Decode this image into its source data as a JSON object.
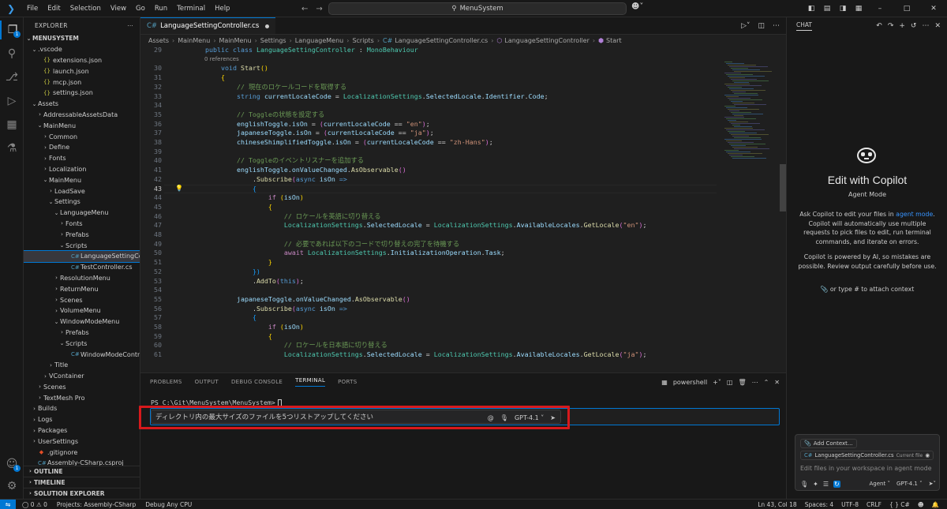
{
  "menubar": [
    "File",
    "Edit",
    "Selection",
    "View",
    "Go",
    "Run",
    "Terminal",
    "Help"
  ],
  "command_center": "MenuSystem",
  "explorer": {
    "title": "EXPLORER",
    "root": "MENUSYSTEM",
    "rows": [
      {
        "depth": 1,
        "type": "folder-open",
        "label": ".vscode"
      },
      {
        "depth": 2,
        "type": "json",
        "label": "extensions.json"
      },
      {
        "depth": 2,
        "type": "json",
        "label": "launch.json"
      },
      {
        "depth": 2,
        "type": "json",
        "label": "mcp.json"
      },
      {
        "depth": 2,
        "type": "json",
        "label": "settings.json"
      },
      {
        "depth": 1,
        "type": "folder-open",
        "label": "Assets"
      },
      {
        "depth": 2,
        "type": "folder",
        "label": "AddressableAssetsData"
      },
      {
        "depth": 2,
        "type": "folder-open",
        "label": "MainMenu"
      },
      {
        "depth": 3,
        "type": "folder",
        "label": "Common"
      },
      {
        "depth": 3,
        "type": "folder",
        "label": "Define"
      },
      {
        "depth": 3,
        "type": "folder",
        "label": "Fonts"
      },
      {
        "depth": 3,
        "type": "folder",
        "label": "Localization"
      },
      {
        "depth": 3,
        "type": "folder-open",
        "label": "MainMenu"
      },
      {
        "depth": 4,
        "type": "folder",
        "label": "LoadSave"
      },
      {
        "depth": 4,
        "type": "folder-open",
        "label": "Settings"
      },
      {
        "depth": 5,
        "type": "folder-open",
        "label": "LanguageMenu"
      },
      {
        "depth": 6,
        "type": "folder",
        "label": "Fonts"
      },
      {
        "depth": 6,
        "type": "folder",
        "label": "Prefabs"
      },
      {
        "depth": 6,
        "type": "folder-open",
        "label": "Scripts"
      },
      {
        "depth": 7,
        "type": "cs",
        "label": "LanguageSettingControll...",
        "selected": true
      },
      {
        "depth": 7,
        "type": "cs",
        "label": "TestController.cs"
      },
      {
        "depth": 5,
        "type": "folder",
        "label": "ResolutionMenu"
      },
      {
        "depth": 5,
        "type": "folder",
        "label": "ReturnMenu"
      },
      {
        "depth": 5,
        "type": "folder",
        "label": "Scenes"
      },
      {
        "depth": 5,
        "type": "folder",
        "label": "VolumeMenu"
      },
      {
        "depth": 5,
        "type": "folder-open",
        "label": "WindowModeMenu"
      },
      {
        "depth": 6,
        "type": "folder",
        "label": "Prefabs"
      },
      {
        "depth": 6,
        "type": "folder-open",
        "label": "Scripts"
      },
      {
        "depth": 7,
        "type": "cs",
        "label": "WindowModeController.cs"
      },
      {
        "depth": 4,
        "type": "folder",
        "label": "Title"
      },
      {
        "depth": 3,
        "type": "folder",
        "label": "VContainer"
      },
      {
        "depth": 2,
        "type": "folder",
        "label": "Scenes"
      },
      {
        "depth": 2,
        "type": "folder",
        "label": "TextMesh Pro"
      },
      {
        "depth": 1,
        "type": "folder",
        "label": "Builds"
      },
      {
        "depth": 1,
        "type": "folder",
        "label": "Logs"
      },
      {
        "depth": 1,
        "type": "folder",
        "label": "Packages"
      },
      {
        "depth": 1,
        "type": "folder",
        "label": "UserSettings"
      },
      {
        "depth": 1,
        "type": "git",
        "label": ".gitignore"
      },
      {
        "depth": 1,
        "type": "cs",
        "label": "Assembly-CSharp.csproj"
      }
    ],
    "outline": "OUTLINE",
    "timeline": "TIMELINE",
    "solution": "SOLUTION EXPLORER"
  },
  "editor": {
    "tab": "LanguageSettingController.cs",
    "breadcrumb": [
      "Assets",
      "MainMenu",
      "MainMenu",
      "Settings",
      "LanguageMenu",
      "Scripts",
      "LanguageSettingController.cs",
      "LanguageSettingController",
      "Start"
    ],
    "references": "0 references",
    "current_line": "43",
    "lines": [
      {
        "n": "29",
        "code": [
          [
            "    ",
            ""
          ],
          [
            "public",
            "kw"
          ],
          [
            " ",
            ""
          ],
          [
            "class",
            "kw"
          ],
          [
            " ",
            ""
          ],
          [
            "LanguageSettingController",
            "ty"
          ],
          [
            " : ",
            "pu"
          ],
          [
            "MonoBehaviour",
            "ty"
          ]
        ]
      },
      {
        "n": "",
        "code": []
      },
      {
        "n": "30",
        "code": [
          [
            "        ",
            ""
          ],
          [
            "void",
            "kw"
          ],
          [
            " ",
            ""
          ],
          [
            "Start",
            "fn"
          ],
          [
            "()",
            "br1"
          ]
        ]
      },
      {
        "n": "31",
        "code": [
          [
            "        ",
            ""
          ],
          [
            "{",
            "br1"
          ]
        ]
      },
      {
        "n": "32",
        "code": [
          [
            "            ",
            ""
          ],
          [
            "// 現在のロケールコードを取得する",
            "cm"
          ]
        ]
      },
      {
        "n": "33",
        "code": [
          [
            "            ",
            ""
          ],
          [
            "string",
            "kw"
          ],
          [
            " ",
            ""
          ],
          [
            "currentLocaleCode",
            "vr"
          ],
          [
            " = ",
            "pu"
          ],
          [
            "LocalizationSettings",
            "ty"
          ],
          [
            ".",
            "pu"
          ],
          [
            "SelectedLocale",
            "vr"
          ],
          [
            ".",
            "pu"
          ],
          [
            "Identifier",
            "vr"
          ],
          [
            ".",
            "pu"
          ],
          [
            "Code",
            "vr"
          ],
          [
            ";",
            "pu"
          ]
        ]
      },
      {
        "n": "34",
        "code": []
      },
      {
        "n": "35",
        "code": [
          [
            "            ",
            ""
          ],
          [
            "// Toggleの状態を設定する",
            "cm"
          ]
        ]
      },
      {
        "n": "36",
        "code": [
          [
            "            ",
            ""
          ],
          [
            "englishToggle",
            "vr"
          ],
          [
            ".",
            "pu"
          ],
          [
            "isOn",
            "vr"
          ],
          [
            " = ",
            "pu"
          ],
          [
            "(",
            "br2"
          ],
          [
            "currentLocaleCode",
            "vr"
          ],
          [
            " == ",
            "pu"
          ],
          [
            "\"en\"",
            "str"
          ],
          [
            ")",
            "br2"
          ],
          [
            ";",
            "pu"
          ]
        ]
      },
      {
        "n": "37",
        "code": [
          [
            "            ",
            ""
          ],
          [
            "japaneseToggle",
            "vr"
          ],
          [
            ".",
            "pu"
          ],
          [
            "isOn",
            "vr"
          ],
          [
            " = ",
            "pu"
          ],
          [
            "(",
            "br2"
          ],
          [
            "currentLocaleCode",
            "vr"
          ],
          [
            " == ",
            "pu"
          ],
          [
            "\"ja\"",
            "str"
          ],
          [
            ")",
            "br2"
          ],
          [
            ";",
            "pu"
          ]
        ]
      },
      {
        "n": "38",
        "code": [
          [
            "            ",
            ""
          ],
          [
            "chineseShimplifiedToggle",
            "vr"
          ],
          [
            ".",
            "pu"
          ],
          [
            "isOn",
            "vr"
          ],
          [
            " = ",
            "pu"
          ],
          [
            "(",
            "br2"
          ],
          [
            "currentLocaleCode",
            "vr"
          ],
          [
            " == ",
            "pu"
          ],
          [
            "\"zh-Hans\"",
            "str"
          ],
          [
            ")",
            "br2"
          ],
          [
            ";",
            "pu"
          ]
        ]
      },
      {
        "n": "39",
        "code": []
      },
      {
        "n": "40",
        "code": [
          [
            "            ",
            ""
          ],
          [
            "// Toggleのイベントリスナーを追加する",
            "cm"
          ]
        ]
      },
      {
        "n": "41",
        "code": [
          [
            "            ",
            ""
          ],
          [
            "englishToggle",
            "vr"
          ],
          [
            ".",
            "pu"
          ],
          [
            "onValueChanged",
            "vr"
          ],
          [
            ".",
            "pu"
          ],
          [
            "AsObservable",
            "fn"
          ],
          [
            "()",
            "br2"
          ]
        ]
      },
      {
        "n": "42",
        "code": [
          [
            "                ",
            ""
          ],
          [
            ".",
            "pu"
          ],
          [
            "Subscribe",
            "fn"
          ],
          [
            "(",
            "br2"
          ],
          [
            "async",
            "kw"
          ],
          [
            " ",
            ""
          ],
          [
            "isOn",
            "vr"
          ],
          [
            " =>",
            "kw"
          ]
        ]
      },
      {
        "n": "43",
        "code": [
          [
            "                ",
            ""
          ],
          [
            "{",
            "br3"
          ]
        ]
      },
      {
        "n": "44",
        "code": [
          [
            "                    ",
            ""
          ],
          [
            "if",
            "ctl"
          ],
          [
            " ",
            ""
          ],
          [
            "(",
            "br1"
          ],
          [
            "isOn",
            "vr"
          ],
          [
            ")",
            "br1"
          ]
        ]
      },
      {
        "n": "45",
        "code": [
          [
            "                    ",
            ""
          ],
          [
            "{",
            "br1"
          ]
        ]
      },
      {
        "n": "46",
        "code": [
          [
            "                        ",
            ""
          ],
          [
            "// ロケールを英語に切り替える",
            "cm"
          ]
        ]
      },
      {
        "n": "47",
        "code": [
          [
            "                        ",
            ""
          ],
          [
            "LocalizationSettings",
            "ty"
          ],
          [
            ".",
            "pu"
          ],
          [
            "SelectedLocale",
            "vr"
          ],
          [
            " = ",
            "pu"
          ],
          [
            "LocalizationSettings",
            "ty"
          ],
          [
            ".",
            "pu"
          ],
          [
            "AvailableLocales",
            "vr"
          ],
          [
            ".",
            "pu"
          ],
          [
            "GetLocale",
            "fn"
          ],
          [
            "(",
            "br2"
          ],
          [
            "\"en\"",
            "str"
          ],
          [
            ")",
            "br2"
          ],
          [
            ";",
            "pu"
          ]
        ]
      },
      {
        "n": "48",
        "code": []
      },
      {
        "n": "49",
        "code": [
          [
            "                        ",
            ""
          ],
          [
            "// 必要であれば以下のコードで切り替えの完了を待機する",
            "cm"
          ]
        ]
      },
      {
        "n": "50",
        "code": [
          [
            "                        ",
            ""
          ],
          [
            "await",
            "ctl"
          ],
          [
            " ",
            ""
          ],
          [
            "LocalizationSettings",
            "ty"
          ],
          [
            ".",
            "pu"
          ],
          [
            "InitializationOperation",
            "vr"
          ],
          [
            ".",
            "pu"
          ],
          [
            "Task",
            "vr"
          ],
          [
            ";",
            "pu"
          ]
        ]
      },
      {
        "n": "51",
        "code": [
          [
            "                    ",
            ""
          ],
          [
            "}",
            "br1"
          ]
        ]
      },
      {
        "n": "52",
        "code": [
          [
            "                ",
            ""
          ],
          [
            "})",
            "br3"
          ]
        ]
      },
      {
        "n": "53",
        "code": [
          [
            "                ",
            ""
          ],
          [
            ".",
            "pu"
          ],
          [
            "AddTo",
            "fn"
          ],
          [
            "(",
            "br2"
          ],
          [
            "this",
            "kw"
          ],
          [
            ")",
            "br2"
          ],
          [
            ";",
            "pu"
          ]
        ]
      },
      {
        "n": "54",
        "code": []
      },
      {
        "n": "55",
        "code": [
          [
            "            ",
            ""
          ],
          [
            "japaneseToggle",
            "vr"
          ],
          [
            ".",
            "pu"
          ],
          [
            "onValueChanged",
            "vr"
          ],
          [
            ".",
            "pu"
          ],
          [
            "AsObservable",
            "fn"
          ],
          [
            "()",
            "br2"
          ]
        ]
      },
      {
        "n": "56",
        "code": [
          [
            "                ",
            ""
          ],
          [
            ".",
            "pu"
          ],
          [
            "Subscribe",
            "fn"
          ],
          [
            "(",
            "br2"
          ],
          [
            "async",
            "kw"
          ],
          [
            " ",
            ""
          ],
          [
            "isOn",
            "vr"
          ],
          [
            " =>",
            "kw"
          ]
        ]
      },
      {
        "n": "57",
        "code": [
          [
            "                ",
            ""
          ],
          [
            "{",
            "br3"
          ]
        ]
      },
      {
        "n": "58",
        "code": [
          [
            "                    ",
            ""
          ],
          [
            "if",
            "ctl"
          ],
          [
            " ",
            ""
          ],
          [
            "(",
            "br1"
          ],
          [
            "isOn",
            "vr"
          ],
          [
            ")",
            "br1"
          ]
        ]
      },
      {
        "n": "59",
        "code": [
          [
            "                    ",
            ""
          ],
          [
            "{",
            "br1"
          ]
        ]
      },
      {
        "n": "60",
        "code": [
          [
            "                        ",
            ""
          ],
          [
            "// ロケールを日本語に切り替える",
            "cm"
          ]
        ]
      },
      {
        "n": "61",
        "code": [
          [
            "                        ",
            ""
          ],
          [
            "LocalizationSettings",
            "ty"
          ],
          [
            ".",
            "pu"
          ],
          [
            "SelectedLocale",
            "vr"
          ],
          [
            " = ",
            "pu"
          ],
          [
            "LocalizationSettings",
            "ty"
          ],
          [
            ".",
            "pu"
          ],
          [
            "AvailableLocales",
            "vr"
          ],
          [
            ".",
            "pu"
          ],
          [
            "GetLocale",
            "fn"
          ],
          [
            "(",
            "br2"
          ],
          [
            "\"ja\"",
            "str"
          ],
          [
            ")",
            "br2"
          ],
          [
            ";",
            "pu"
          ]
        ]
      }
    ]
  },
  "panel": {
    "tabs": [
      "PROBLEMS",
      "OUTPUT",
      "DEBUG CONSOLE",
      "TERMINAL",
      "PORTS"
    ],
    "active_tab": "TERMINAL",
    "shell": "powershell",
    "prompt": "PS C:\\Git\\MenuSystem\\MenuSystem>",
    "inline_chat_text": "ディレクトリ内の最大サイズのファイルを5つリストアップしてください",
    "model": "GPT-4.1"
  },
  "chat": {
    "header": "CHAT",
    "title": "Edit with Copilot",
    "mode": "Agent Mode",
    "desc_pre": "Ask Copilot to edit your files in ",
    "desc_link": "agent mode",
    "desc_post": ". Copilot will automatically use multiple requests to pick files to edit, run terminal commands, and iterate on errors.",
    "note": "Copilot is powered by AI, so mistakes are possible. Review output carefully before use.",
    "attach_hint": "or type # to attach context",
    "add_context": "Add Context...",
    "current_file_name": "LanguageSettingController.cs",
    "current_file_tag": "Current file",
    "placeholder": "Edit files in your workspace in agent mode",
    "agent_label": "Agent",
    "model": "GPT-4.1"
  },
  "status": {
    "errors": "0",
    "warnings": "0",
    "project": "Projects: Assembly-CSharp",
    "debug": "Debug Any CPU",
    "position": "Ln 43, Col 18",
    "spaces": "Spaces: 4",
    "encoding": "UTF-8",
    "eol": "CRLF",
    "language": "C#"
  }
}
